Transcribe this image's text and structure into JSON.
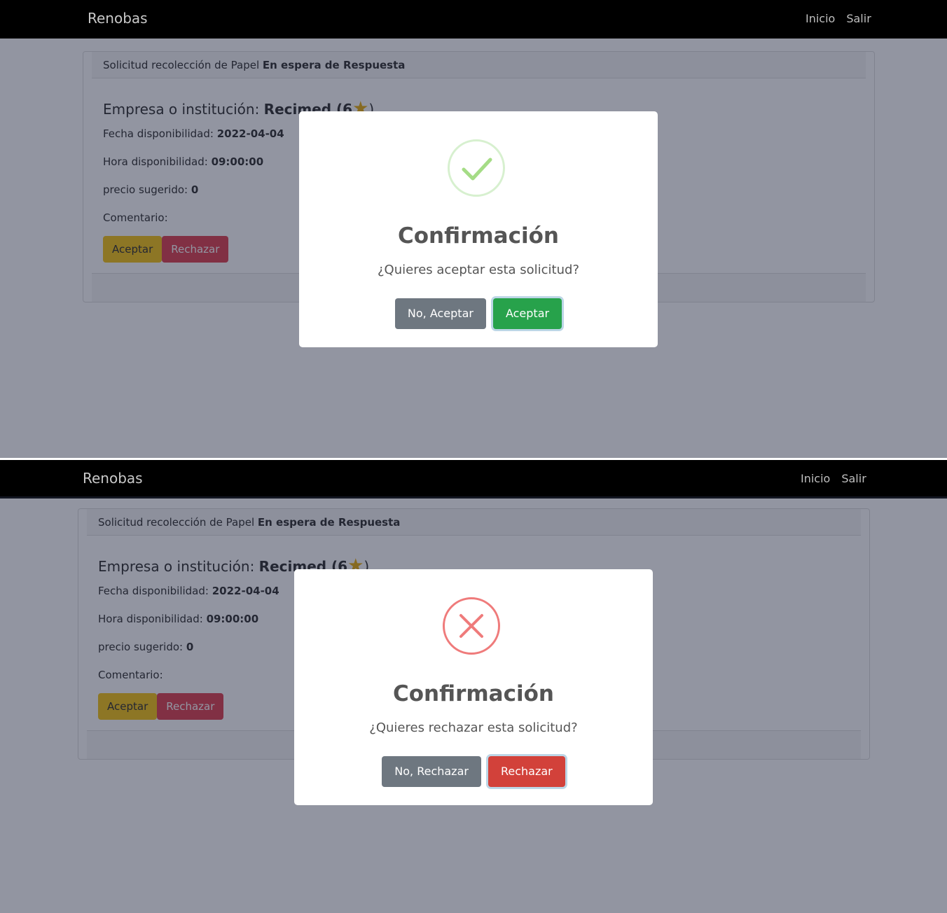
{
  "colors": {
    "navbar": "#000000",
    "overlay": "#262c44",
    "warn": "#f5c107",
    "danger": "#dc3545",
    "success": "#27a24b",
    "grey": "#6e7780",
    "star": "#e6a800"
  },
  "top": {
    "nav": {
      "brand": "Renobas",
      "links": [
        "Inicio",
        "Salir"
      ]
    },
    "card": {
      "header_text": "Solicitud recolección de Papel",
      "header_status": "En espera de Respuesta",
      "company_label": "Empresa o institución:",
      "company_value": "Recimed (6",
      "company_close": ")",
      "fecha_label": "Fecha disponibilidad:",
      "fecha_value": "2022-04-04",
      "hora_label": "Hora disponibilidad:",
      "hora_value": "09:00:00",
      "precio_label": "precio sugerido:",
      "precio_value": "0",
      "comentario_label": "Comentario:",
      "accept_label": "Aceptar",
      "reject_label": "Rechazar"
    },
    "modal": {
      "icon": "success-check-icon",
      "title": "Confirmación",
      "text": "¿Quieres aceptar esta solicitud?",
      "cancel_label": "No, Aceptar",
      "confirm_label": "Aceptar"
    }
  },
  "bottom": {
    "nav": {
      "brand": "Renobas",
      "links": [
        "Inicio",
        "Salir"
      ]
    },
    "card": {
      "header_text": "Solicitud recolección de Papel",
      "header_status": "En espera de Respuesta",
      "company_label": "Empresa o institución:",
      "company_value": "Recimed (6",
      "company_close": ")",
      "fecha_label": "Fecha disponibilidad:",
      "fecha_value": "2022-04-04",
      "hora_label": "Hora disponibilidad:",
      "hora_value": "09:00:00",
      "precio_label": "precio sugerido:",
      "precio_value": "0",
      "comentario_label": "Comentario:",
      "accept_label": "Aceptar",
      "reject_label": "Rechazar"
    },
    "modal": {
      "icon": "error-x-icon",
      "title": "Confirmación",
      "text": "¿Quieres rechazar esta solicitud?",
      "cancel_label": "No, Rechazar",
      "confirm_label": "Rechazar"
    }
  }
}
